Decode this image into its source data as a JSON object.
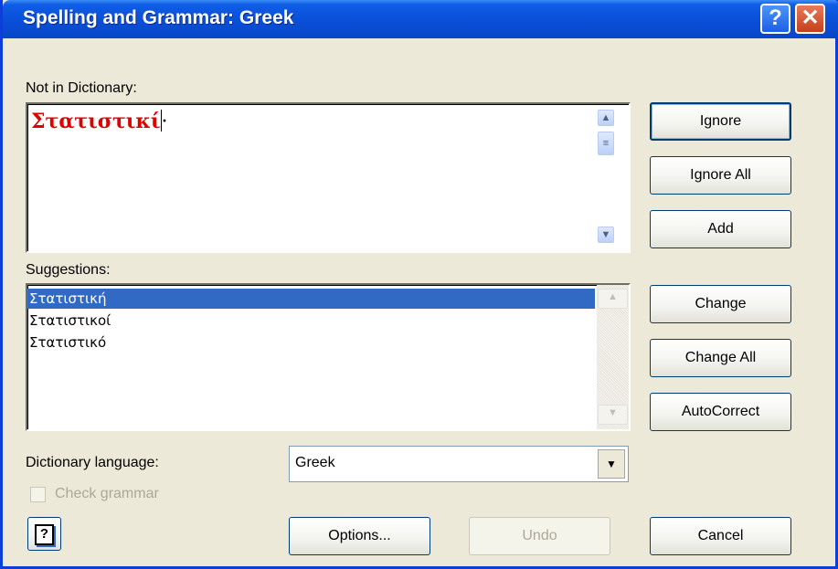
{
  "window": {
    "title": "Spelling and Grammar: Greek",
    "help_glyph": "?",
    "close_glyph": "✕"
  },
  "not_in_dictionary": {
    "label": "Not in Dictionary:",
    "text": "Στατιστικί",
    "trailing": "·"
  },
  "suggestions": {
    "label": "Suggestions:",
    "items": [
      "Στατιστική",
      "Στατιστικοί",
      "Στατιστικό"
    ],
    "selected_index": 0
  },
  "buttons": {
    "ignore": "Ignore",
    "ignore_all": "Ignore All",
    "add": "Add",
    "change": "Change",
    "change_all": "Change All",
    "autocorrect": "AutoCorrect",
    "options": "Options...",
    "undo": "Undo",
    "cancel": "Cancel"
  },
  "dictionary_language": {
    "label": "Dictionary language:",
    "value": "Greek"
  },
  "check_grammar": {
    "label": "Check grammar",
    "checked": false,
    "enabled": false
  },
  "colors": {
    "error_text": "#e00000",
    "selection": "#316ac5",
    "title_bar": "#0a4fd8"
  }
}
